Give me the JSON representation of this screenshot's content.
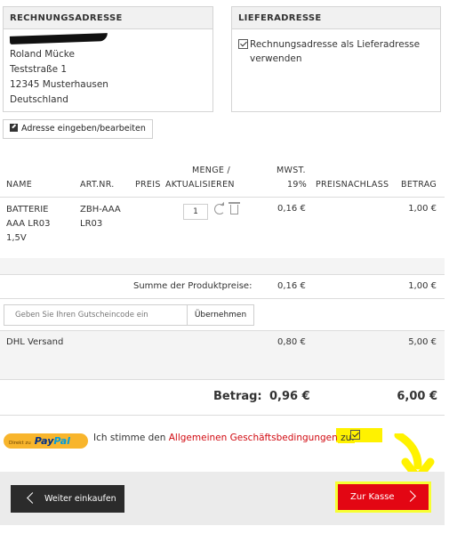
{
  "billing": {
    "title": "RECHNUNGSADRESSE",
    "lines": [
      "Roland Mücke",
      "Teststraße 1",
      "12345 Musterhausen",
      "Deutschland"
    ]
  },
  "shipping": {
    "title": "LIEFERADRESSE",
    "checkbox_label": "Rechnungsadresse als Lieferadresse verwenden",
    "checked": true
  },
  "edit_address_label": "Adresse eingeben/bearbeiten",
  "table": {
    "headers": {
      "name": "NAME",
      "artnr": "ART.NR.",
      "price": "PREIS",
      "qty_line1": "MENGE /",
      "qty_line2": "AKTUALISIEREN",
      "vat_line1": "MWST.",
      "vat_line2": "19%",
      "discount": "PREISNACHLASS",
      "amount": "BETRAG"
    },
    "rows": [
      {
        "name_lines": [
          "BATTERIE",
          "AAA LR03",
          "1,5V"
        ],
        "artnr_lines": [
          "ZBH-AAA",
          "LR03"
        ],
        "quantity": "1",
        "vat": "0,16 €",
        "amount": "1,00 €"
      }
    ]
  },
  "subtotal": {
    "label": "Summe der Produktpreise:",
    "vat": "0,16 €",
    "amount": "1,00 €"
  },
  "coupon": {
    "placeholder": "Geben Sie Ihren Gutscheincode ein",
    "button_label": "Übernehmen"
  },
  "shipping_cost": {
    "label": "DHL Versand",
    "vat": "0,80 €",
    "amount": "5,00 €"
  },
  "total": {
    "label": "Betrag:",
    "vat": "0,96 €",
    "amount": "6,00 €"
  },
  "paypal": {
    "prefix": "Direkt zu",
    "brand_dark": "Pay",
    "brand_light": "Pal"
  },
  "terms": {
    "before": "Ich stimme den ",
    "link": "Allgemeinen Geschäftsbedingungen",
    "after": " zu.",
    "checked": true
  },
  "buttons": {
    "continue": "Weiter einkaufen",
    "checkout": "Zur Kasse"
  },
  "colors": {
    "accent_red": "#e30613",
    "highlight": "#fff200",
    "dark_button": "#2b2b2b"
  },
  "icons": [
    "edit-icon",
    "refresh-icon",
    "trash-icon",
    "checkbox-icon",
    "chevron-left-icon",
    "chevron-right-icon",
    "arrow-annotation-icon"
  ]
}
